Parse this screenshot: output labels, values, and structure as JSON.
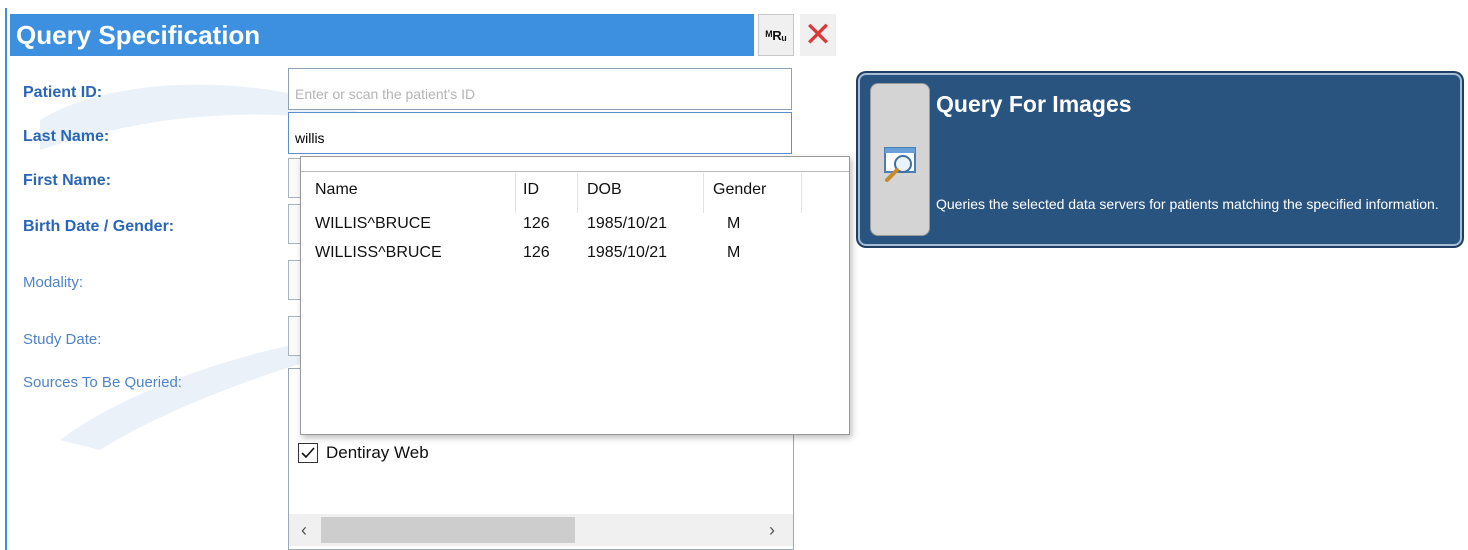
{
  "header": {
    "title": "Query Specification"
  },
  "toolbar": {
    "mru_label": "ᴹRᵤ",
    "close_label": "✕"
  },
  "form": {
    "patient_id_label": "Patient ID:",
    "patient_id_placeholder": "Enter or scan the patient's ID",
    "patient_id_value": "",
    "last_name_label": "Last Name:",
    "last_name_value": "willis",
    "first_name_label": "First Name:",
    "birth_gender_label": "Birth Date / Gender:",
    "modality_label": "Modality:",
    "study_date_label": "Study Date:",
    "sources_label": "Sources To Be Queried:"
  },
  "sources": [
    {
      "label": "Dentiray Web",
      "checked": true
    }
  ],
  "autocomplete": {
    "columns": [
      "Name",
      "ID",
      "DOB",
      "Gender"
    ],
    "rows": [
      {
        "name": "WILLIS^BRUCE",
        "id": "126",
        "dob": "1985/10/21",
        "gender": "M"
      },
      {
        "name": "WILLISS^BRUCE",
        "id": "126",
        "dob": "1985/10/21",
        "gender": "M"
      }
    ]
  },
  "query_panel": {
    "title": "Query For Images",
    "description": "Queries the selected data servers for patients matching the specified information."
  },
  "colors": {
    "title_bar": "#3d8fe0",
    "panel": "#2a5480",
    "label": "#2a66b8"
  }
}
